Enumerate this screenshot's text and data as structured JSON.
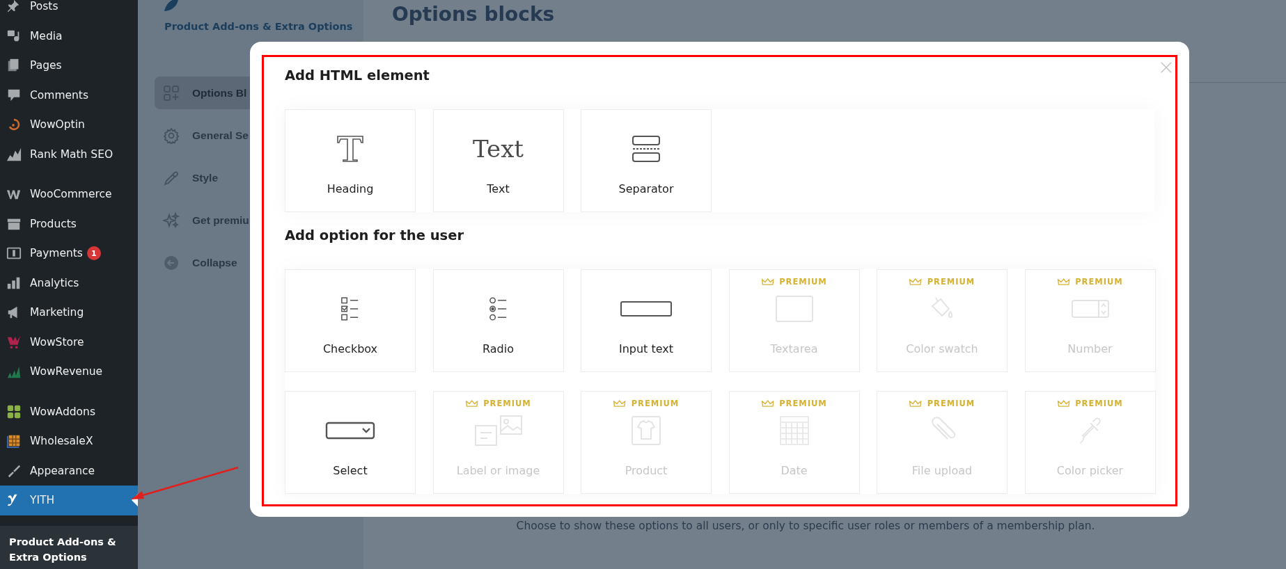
{
  "sidebar": {
    "groups": [
      {
        "items": [
          {
            "label": "Posts",
            "selected": false
          },
          {
            "label": "Media",
            "selected": false
          },
          {
            "label": "Pages",
            "selected": false
          },
          {
            "label": "Comments",
            "selected": false
          },
          {
            "label": "WowOptin",
            "selected": false
          },
          {
            "label": "Rank Math SEO",
            "selected": false
          }
        ]
      },
      {
        "items": [
          {
            "label": "WooCommerce",
            "selected": false
          },
          {
            "label": "Products",
            "selected": false
          },
          {
            "label": "Payments",
            "selected": false,
            "badge": "1"
          },
          {
            "label": "Analytics",
            "selected": false
          },
          {
            "label": "Marketing",
            "selected": false
          },
          {
            "label": "WowStore",
            "selected": false
          },
          {
            "label": "WowRevenue",
            "selected": false
          }
        ]
      },
      {
        "items": [
          {
            "label": "WowAddons",
            "selected": false
          },
          {
            "label": "WholesaleX",
            "selected": false
          },
          {
            "label": "Appearance",
            "selected": false
          },
          {
            "label": "YITH",
            "selected": true
          }
        ]
      }
    ],
    "submenu": {
      "label": "Product Add-ons & Extra Options"
    }
  },
  "plugin_nav": {
    "title": "Product Add-ons & Extra Options",
    "items": [
      {
        "label": "Options Bl",
        "selected": true
      },
      {
        "label": "General Se",
        "selected": false
      },
      {
        "label": "Style",
        "selected": false
      },
      {
        "label": "Get premiu",
        "selected": false
      },
      {
        "label": "Collapse",
        "selected": false
      }
    ]
  },
  "page": {
    "title": "Options blocks",
    "note": "Choose to show these options to all users, or only to specific user roles or members of a membership plan."
  },
  "modal": {
    "sections": [
      {
        "title": "Add HTML element",
        "cards": [
          {
            "kind": "heading",
            "label": "Heading",
            "premium": false
          },
          {
            "kind": "text",
            "label": "Text",
            "icon_text": "Text",
            "premium": false
          },
          {
            "kind": "separator",
            "label": "Separator",
            "premium": false
          }
        ]
      },
      {
        "title": "Add option for the user",
        "cards": [
          {
            "kind": "checkbox",
            "label": "Checkbox",
            "premium": false
          },
          {
            "kind": "radio",
            "label": "Radio",
            "premium": false
          },
          {
            "kind": "input",
            "label": "Input text",
            "premium": false
          },
          {
            "kind": "textarea",
            "label": "Textarea",
            "premium": true,
            "badge": "PREMIUM"
          },
          {
            "kind": "swatch",
            "label": "Color swatch",
            "premium": true,
            "badge": "PREMIUM"
          },
          {
            "kind": "number",
            "label": "Number",
            "premium": true,
            "badge": "PREMIUM"
          },
          {
            "kind": "select",
            "label": "Select",
            "premium": false
          },
          {
            "kind": "labelimage",
            "label": "Label or image",
            "premium": true,
            "badge": "PREMIUM"
          },
          {
            "kind": "product",
            "label": "Product",
            "premium": true,
            "badge": "PREMIUM"
          },
          {
            "kind": "date",
            "label": "Date",
            "premium": true,
            "badge": "PREMIUM"
          },
          {
            "kind": "upload",
            "label": "File upload",
            "premium": true,
            "badge": "PREMIUM"
          },
          {
            "kind": "picker",
            "label": "Color picker",
            "premium": true,
            "badge": "PREMIUM"
          }
        ]
      }
    ]
  }
}
